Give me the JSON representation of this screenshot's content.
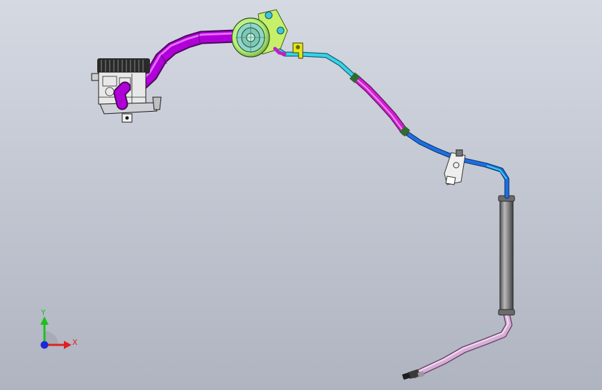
{
  "app": {
    "title": ""
  },
  "view": {
    "background": "gradient-grey"
  },
  "triad": {
    "x_label": "X",
    "y_label": "Y",
    "x_color": "#e02020",
    "y_color": "#1cc01c",
    "z_color": "#1a2ad8"
  },
  "colors": {
    "pressure_hose": "#b000d8",
    "return_line_cyan": "#34d4e6",
    "return_line_blue": "#1e6fe0",
    "magenta_section": "#d21ed2",
    "reservoir": "#b6ef7a",
    "bracket_yellow": "#e6e619",
    "cooler_tube": "#7d7d7d",
    "pink_tube": "#d8aed8"
  },
  "parts": [
    {
      "name": "power-steering-pump",
      "icon": "pump-icon"
    },
    {
      "name": "pressure-hose",
      "icon": "hose-icon"
    },
    {
      "name": "reservoir",
      "icon": "reservoir-icon"
    },
    {
      "name": "clip-bracket",
      "icon": "bracket-icon"
    },
    {
      "name": "return-line",
      "icon": "tube-icon"
    },
    {
      "name": "mount-bracket",
      "icon": "bracket-icon"
    },
    {
      "name": "oil-cooler",
      "icon": "cooler-icon"
    },
    {
      "name": "end-fitting",
      "icon": "fitting-icon"
    }
  ]
}
